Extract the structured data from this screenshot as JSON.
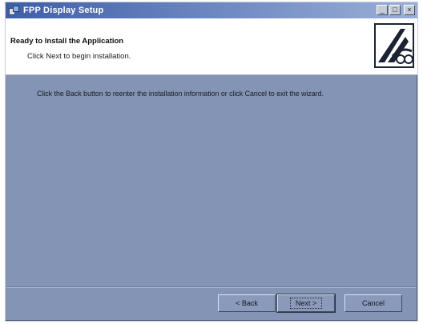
{
  "window": {
    "title": "FPP Display Setup",
    "controls": {
      "minimize": "_",
      "maximize": "□",
      "close": "×"
    }
  },
  "header": {
    "title": "Ready to Install the Application",
    "subtitle": "Click Next to begin installation."
  },
  "body": {
    "text": "Click the Back button to reenter the installation information or click Cancel to exit the wizard."
  },
  "buttons": {
    "back": "< Back",
    "next": "Next >",
    "cancel": "Cancel"
  }
}
